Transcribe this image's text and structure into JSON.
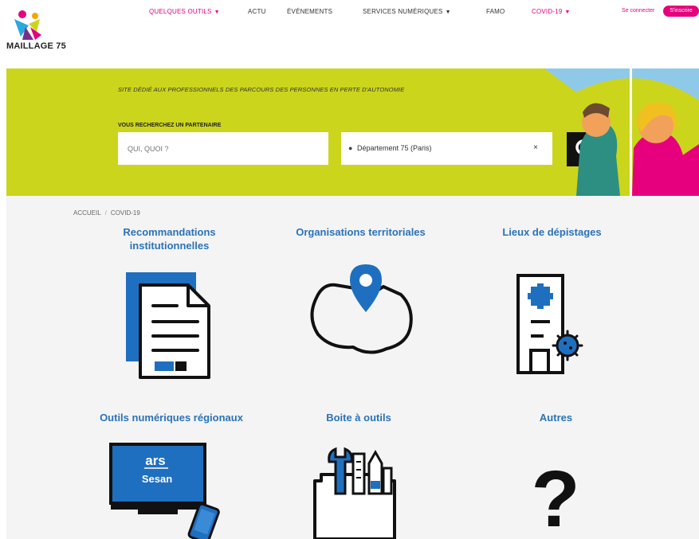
{
  "brand": {
    "name": "MAILLAGE 75"
  },
  "nav": {
    "items": [
      {
        "label": "QUELQUES OUTILS",
        "caret": "▼",
        "highlight": true
      },
      {
        "label": "ACTU",
        "caret": "",
        "highlight": false
      },
      {
        "label": "ÉVÉNEMENTS",
        "caret": "",
        "highlight": false
      },
      {
        "label": "SERVICES NUMÉRIQUES",
        "caret": "▼",
        "highlight": false
      },
      {
        "label": "FAMO",
        "caret": "",
        "highlight": false
      },
      {
        "label": "COVID-19",
        "caret": "▼",
        "highlight": true
      }
    ],
    "login": "Se connecter",
    "register": "S'inscrire"
  },
  "hero": {
    "tagline": "SITE DÉDIÉ AUX PROFESSIONNELS DES PARCOURS DES PERSONNES EN PERTE D'AUTONOMIE",
    "search_label": "VOUS RECHERCHEZ UN PARTENAIRE",
    "search_placeholder": "QUI, QUOI ?",
    "location_value": "Département 75 (Paris)",
    "clear_symbol": "×",
    "globe_icon": "globe-icon",
    "search_icon": "search-icon"
  },
  "breadcrumb": {
    "home": "ACCUEIL",
    "separator": "/",
    "current": "COVID-19"
  },
  "cards": [
    {
      "title": "Recommandations institutionnelles",
      "icon": "document-icon"
    },
    {
      "title": "Organisations territoriales",
      "icon": "map-pin-icon"
    },
    {
      "title": "Lieux de dépistages",
      "icon": "hospital-virus-icon"
    },
    {
      "title": "Outils numériques régionaux",
      "icon": "computer-phone-icon",
      "screen_text_1": "ars",
      "screen_text_2": "Sesan"
    },
    {
      "title": "Boite à outils",
      "icon": "toolbox-icon"
    },
    {
      "title": "Autres",
      "icon": "question-mark-icon",
      "glyph": "?"
    }
  ],
  "colors": {
    "accent_pink": "#e6007e",
    "hero_green": "#cbd51c",
    "title_blue": "#2a73ba",
    "icon_blue": "#1f6fc0"
  }
}
